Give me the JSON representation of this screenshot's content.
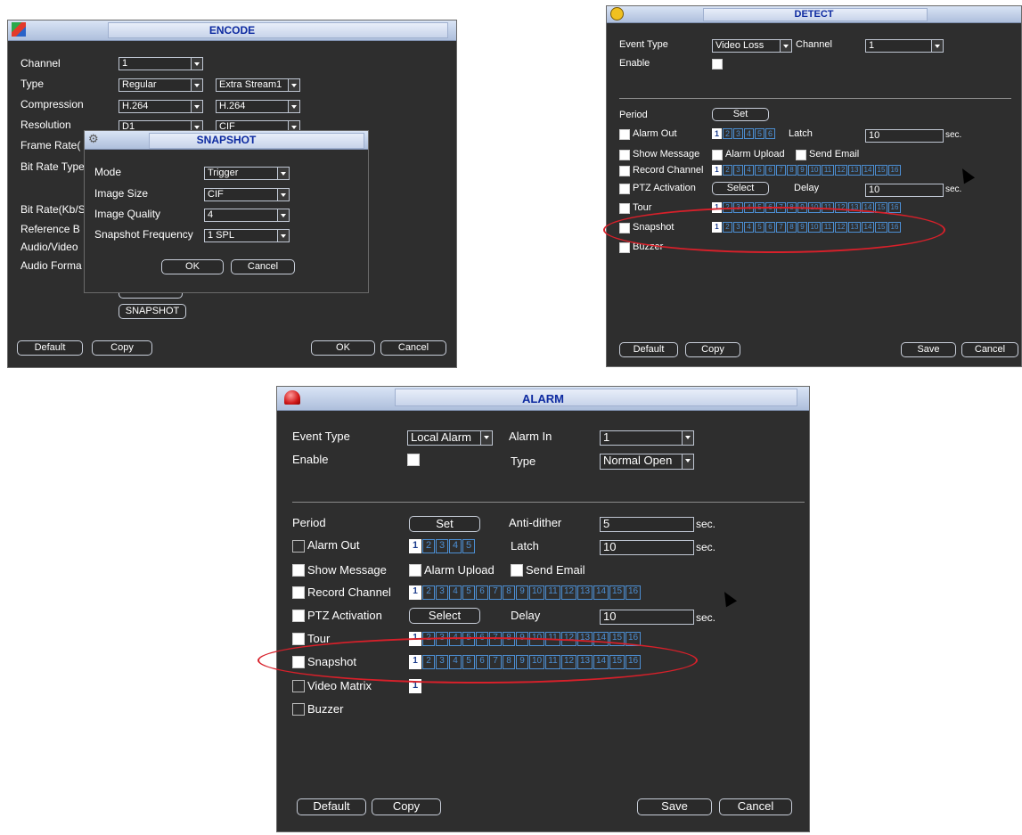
{
  "encode": {
    "title": "ENCODE",
    "labels": {
      "channel": "Channel",
      "type": "Type",
      "compression": "Compression",
      "resolution": "Resolution",
      "frame_rate": "Frame Rate(",
      "bit_rate_type": "Bit Rate Type",
      "bit_rate": "Bit Rate(Kb/S",
      "reference": "Reference B",
      "audio_video": "Audio/Video",
      "audio_format": "Audio Forma"
    },
    "values": {
      "channel": "1",
      "type": "Regular",
      "extra_stream": "Extra Stream1",
      "compression_main": "H.264",
      "compression_extra": "H.264",
      "resolution_main": "D1",
      "resolution_extra": "CIF"
    },
    "buttons": {
      "overlay": "OVERLAY",
      "snapshot": "SNAPSHOT",
      "default": "Default",
      "copy": "Copy",
      "ok": "OK",
      "cancel": "Cancel"
    }
  },
  "snapshot": {
    "title": "SNAPSHOT",
    "labels": {
      "mode": "Mode",
      "image_size": "Image Size",
      "image_quality": "Image Quality",
      "frequency": "Snapshot Frequency"
    },
    "values": {
      "mode": "Trigger",
      "image_size": "CIF",
      "image_quality": "4",
      "frequency": "1 SPL"
    },
    "buttons": {
      "ok": "OK",
      "cancel": "Cancel"
    }
  },
  "detect": {
    "title": "DETECT",
    "labels": {
      "event_type": "Event Type",
      "channel": "Channel",
      "enable": "Enable",
      "period": "Period",
      "alarm_out": "Alarm Out",
      "latch": "Latch",
      "sec": "sec.",
      "show_message": "Show Message",
      "alarm_upload": "Alarm Upload",
      "send_email": "Send Email",
      "record_channel": "Record Channel",
      "ptz_activation": "PTZ Activation",
      "delay": "Delay",
      "tour": "Tour",
      "snapshot": "Snapshot",
      "buzzer": "Buzzer"
    },
    "values": {
      "event_type": "Video Loss",
      "channel": "1",
      "latch": "10",
      "delay": "10"
    },
    "buttons": {
      "set": "Set",
      "select": "Select",
      "default": "Default",
      "copy": "Copy",
      "save": "Save",
      "cancel": "Cancel"
    },
    "alarm_out_channels": [
      "1",
      "2",
      "3",
      "4",
      "5",
      "6"
    ],
    "channels16": [
      "1",
      "2",
      "3",
      "4",
      "5",
      "6",
      "7",
      "8",
      "9",
      "10",
      "11",
      "12",
      "13",
      "14",
      "15",
      "16"
    ]
  },
  "alarm": {
    "title": "ALARM",
    "labels": {
      "event_type": "Event Type",
      "alarm_in": "Alarm In",
      "enable": "Enable",
      "type": "Type",
      "period": "Period",
      "anti_dither": "Anti-dither",
      "sec": "sec.",
      "alarm_out": "Alarm Out",
      "latch": "Latch",
      "show_message": "Show Message",
      "alarm_upload": "Alarm Upload",
      "send_email": "Send Email",
      "record_channel": "Record Channel",
      "ptz_activation": "PTZ Activation",
      "delay": "Delay",
      "tour": "Tour",
      "snapshot": "Snapshot",
      "video_matrix": "Video Matrix",
      "buzzer": "Buzzer"
    },
    "values": {
      "event_type": "Local Alarm",
      "alarm_in": "1",
      "type": "Normal Open",
      "anti_dither": "5",
      "latch": "10",
      "delay": "10"
    },
    "buttons": {
      "set": "Set",
      "select": "Select",
      "default": "Default",
      "copy": "Copy",
      "save": "Save",
      "cancel": "Cancel"
    },
    "alarm_out_channels": [
      "1",
      "2",
      "3",
      "4",
      "5"
    ],
    "channels16": [
      "1",
      "2",
      "3",
      "4",
      "5",
      "6",
      "7",
      "8",
      "9",
      "10",
      "11",
      "12",
      "13",
      "14",
      "15",
      "16"
    ],
    "video_matrix_channels": [
      "1"
    ]
  },
  "colors": {
    "window_bg": "#2e2e2e",
    "title_text": "#0d2aa0",
    "channel_blue": "#4c8fd4",
    "highlight": "#d8202a"
  }
}
